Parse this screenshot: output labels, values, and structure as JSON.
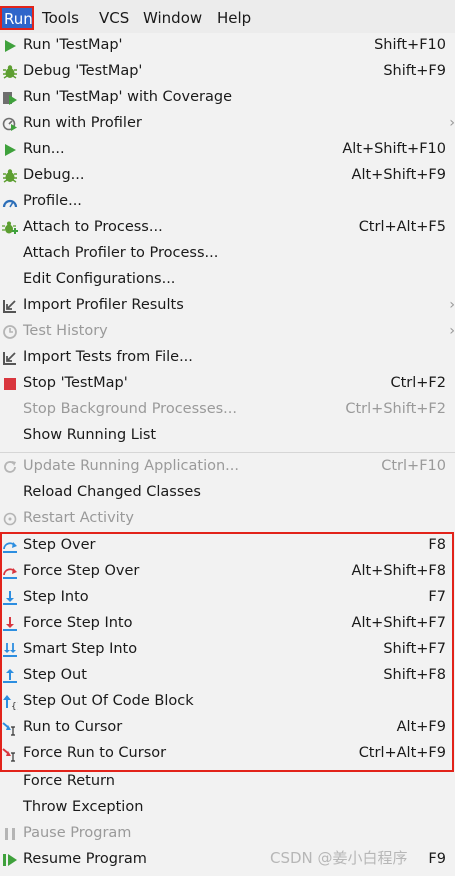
{
  "menubar": {
    "items": [
      {
        "label": "Run"
      },
      {
        "label": "Tools"
      },
      {
        "label": "VCS"
      },
      {
        "label": "Window"
      },
      {
        "label": "Help"
      }
    ]
  },
  "menu": {
    "items": [
      {
        "label": "Run 'TestMap'",
        "shortcut": "Shift+F10",
        "icon": "run-icon",
        "enabled": true
      },
      {
        "label": "Debug 'TestMap'",
        "shortcut": "Shift+F9",
        "icon": "debug-icon",
        "enabled": true
      },
      {
        "label": "Run 'TestMap' with Coverage",
        "shortcut": "",
        "icon": "coverage-icon",
        "enabled": true
      },
      {
        "label": "Run with Profiler",
        "shortcut": "",
        "icon": "profiler-icon",
        "enabled": true,
        "submenu": true
      },
      {
        "label": "Run...",
        "shortcut": "Alt+Shift+F10",
        "icon": "run-icon",
        "enabled": true
      },
      {
        "label": "Debug...",
        "shortcut": "Alt+Shift+F9",
        "icon": "debug-icon",
        "enabled": true
      },
      {
        "label": "Profile...",
        "shortcut": "",
        "icon": "profile-icon",
        "enabled": true
      },
      {
        "label": "Attach to Process...",
        "shortcut": "Ctrl+Alt+F5",
        "icon": "attach-icon",
        "enabled": true
      },
      {
        "label": "Attach Profiler to Process...",
        "shortcut": "",
        "icon": "",
        "enabled": true
      },
      {
        "label": "Edit Configurations...",
        "shortcut": "",
        "icon": "",
        "enabled": true
      },
      {
        "label": "Import Profiler Results",
        "shortcut": "",
        "icon": "import-icon",
        "enabled": true,
        "submenu": true
      },
      {
        "label": "Test History",
        "shortcut": "",
        "icon": "history-icon",
        "enabled": false,
        "submenu": true
      },
      {
        "label": "Import Tests from File...",
        "shortcut": "",
        "icon": "import-icon",
        "enabled": true
      },
      {
        "label": "Stop 'TestMap'",
        "shortcut": "Ctrl+F2",
        "icon": "stop-icon",
        "enabled": true
      },
      {
        "label": "Stop Background Processes...",
        "shortcut": "Ctrl+Shift+F2",
        "icon": "",
        "enabled": false
      },
      {
        "label": "Show Running List",
        "shortcut": "",
        "icon": "",
        "enabled": true
      },
      {
        "label": "Update Running Application...",
        "shortcut": "Ctrl+F10",
        "icon": "update-icon",
        "enabled": false
      },
      {
        "label": "Reload Changed Classes",
        "shortcut": "",
        "icon": "",
        "enabled": true
      },
      {
        "label": "Restart Activity",
        "shortcut": "",
        "icon": "restart-icon",
        "enabled": false
      },
      {
        "label": "Step Over",
        "shortcut": "F8",
        "icon": "step-over-icon",
        "enabled": true
      },
      {
        "label": "Force Step Over",
        "shortcut": "Alt+Shift+F8",
        "icon": "force-step-over-icon",
        "enabled": true
      },
      {
        "label": "Step Into",
        "shortcut": "F7",
        "icon": "step-into-icon",
        "enabled": true
      },
      {
        "label": "Force Step Into",
        "shortcut": "Alt+Shift+F7",
        "icon": "force-step-into-icon",
        "enabled": true
      },
      {
        "label": "Smart Step Into",
        "shortcut": "Shift+F7",
        "icon": "smart-step-into-icon",
        "enabled": true
      },
      {
        "label": "Step Out",
        "shortcut": "Shift+F8",
        "icon": "step-out-icon",
        "enabled": true
      },
      {
        "label": "Step Out Of Code Block",
        "shortcut": "",
        "icon": "step-out-block-icon",
        "enabled": true
      },
      {
        "label": "Run to Cursor",
        "shortcut": "Alt+F9",
        "icon": "run-to-cursor-icon",
        "enabled": true
      },
      {
        "label": "Force Run to Cursor",
        "shortcut": "Ctrl+Alt+F9",
        "icon": "force-run-to-cursor-icon",
        "enabled": true
      },
      {
        "label": "Force Return",
        "shortcut": "",
        "icon": "",
        "enabled": true
      },
      {
        "label": "Throw Exception",
        "shortcut": "",
        "icon": "",
        "enabled": true
      },
      {
        "label": "Pause Program",
        "shortcut": "",
        "icon": "pause-icon",
        "enabled": false
      },
      {
        "label": "Resume Program",
        "shortcut": "F9",
        "icon": "resume-icon",
        "enabled": true
      }
    ]
  },
  "watermark": "CSDN @姜小白程序",
  "colors": {
    "accent": "#2f65ca",
    "highlight_border": "#e2231a",
    "run_green": "#3fa13c",
    "debug_green": "#5c9e30",
    "stop_red": "#d9363e",
    "step_blue": "#2d8ee0"
  }
}
